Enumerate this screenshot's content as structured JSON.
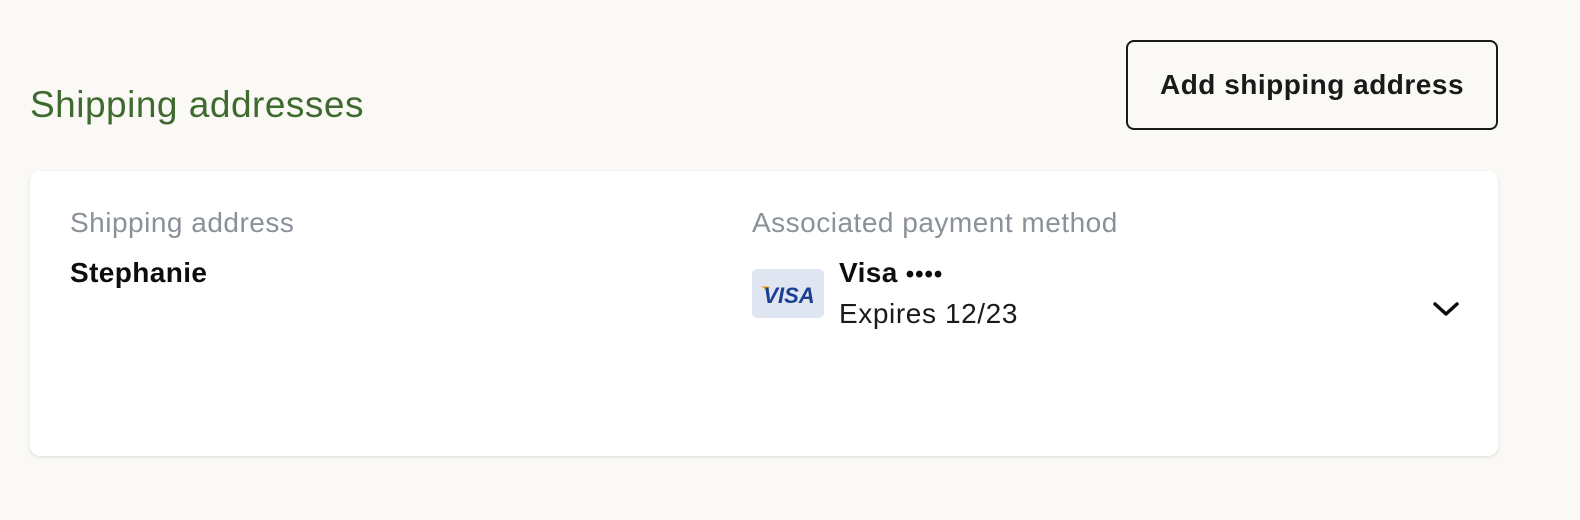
{
  "header": {
    "title": "Shipping addresses",
    "add_button_label": "Add shipping address"
  },
  "address_card": {
    "shipping_label": "Shipping address",
    "recipient_name": "Stephanie",
    "payment_label": "Associated payment method",
    "payment": {
      "brand": "Visa",
      "masked_number": "••••",
      "expiry": "Expires 12/23",
      "logo_text": "VISA",
      "logo_icon": "visa-card-icon"
    },
    "expand_icon": "chevron-down-icon"
  },
  "colors": {
    "page_background": "#faf9f5",
    "title_green": "#3f6a2f",
    "label_gray": "#8a9199",
    "visa_blue": "#1a3f94",
    "visa_badge_bg": "#dfe5f1",
    "visa_accent": "#f7a700"
  }
}
